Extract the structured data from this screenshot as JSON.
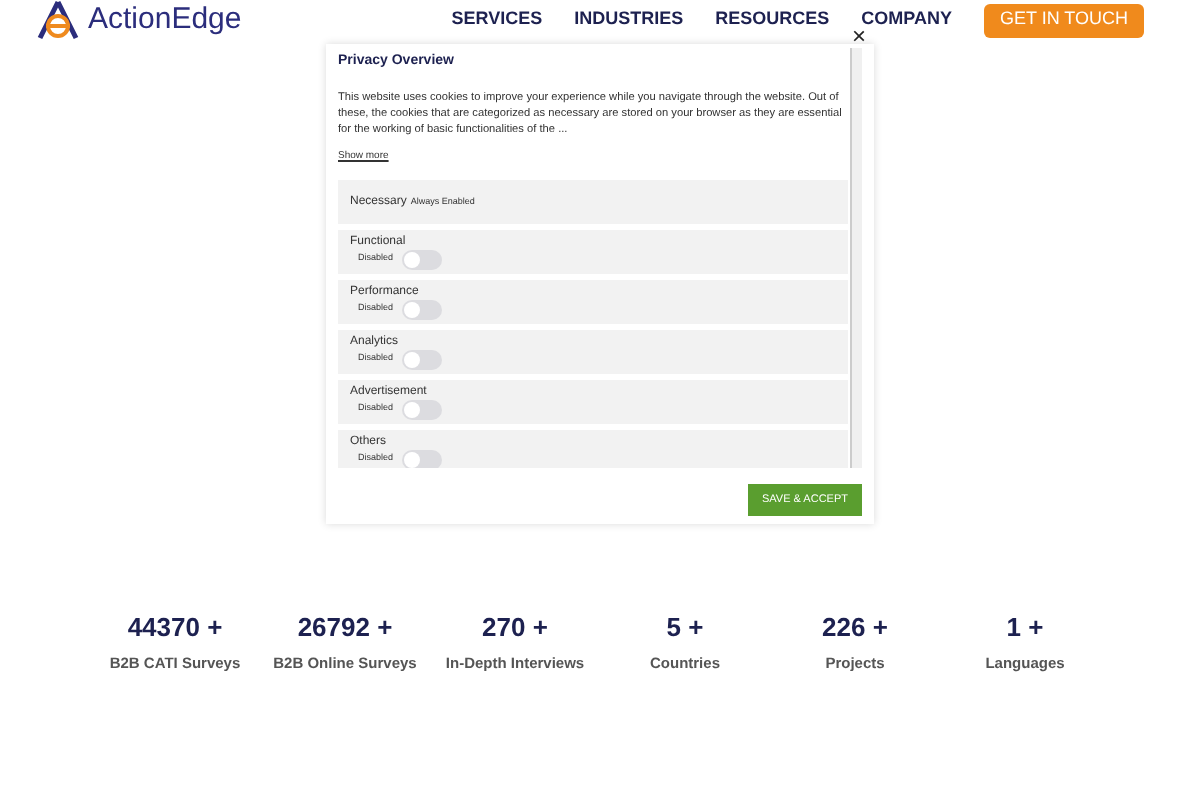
{
  "header": {
    "logo": "ActionEdge",
    "nav": [
      "SERVICES",
      "INDUSTRIES",
      "RESOURCES",
      "COMPANY"
    ],
    "cta": "GET IN TOUCH"
  },
  "modal": {
    "close": "×",
    "title": "Privacy Overview",
    "text": "This website uses cookies to improve your experience while you navigate through the website. Out of these, the cookies that are categorized as necessary are stored on your browser as they are essential for the working of basic functionalities of the ...",
    "show_more": "Show more",
    "categories": [
      {
        "kind": "always",
        "name": "Necessary",
        "status": "Always Enabled"
      },
      {
        "kind": "toggle",
        "name": "Functional",
        "status": "Disabled",
        "on": false
      },
      {
        "kind": "toggle",
        "name": "Performance",
        "status": "Disabled",
        "on": false
      },
      {
        "kind": "toggle",
        "name": "Analytics",
        "status": "Disabled",
        "on": false
      },
      {
        "kind": "toggle",
        "name": "Advertisement",
        "status": "Disabled",
        "on": false
      },
      {
        "kind": "toggle",
        "name": "Others",
        "status": "Disabled",
        "on": false
      }
    ],
    "save": "SAVE & ACCEPT"
  },
  "stats": [
    {
      "value": "44370 +",
      "label": "B2B CATI Surveys"
    },
    {
      "value": "26792 +",
      "label": "B2B Online Surveys"
    },
    {
      "value": "270 +",
      "label": "In-Depth Interviews"
    },
    {
      "value": "5 +",
      "label": "Countries"
    },
    {
      "value": "226 +",
      "label": "Projects"
    },
    {
      "value": "1 +",
      "label": "Languages"
    }
  ]
}
